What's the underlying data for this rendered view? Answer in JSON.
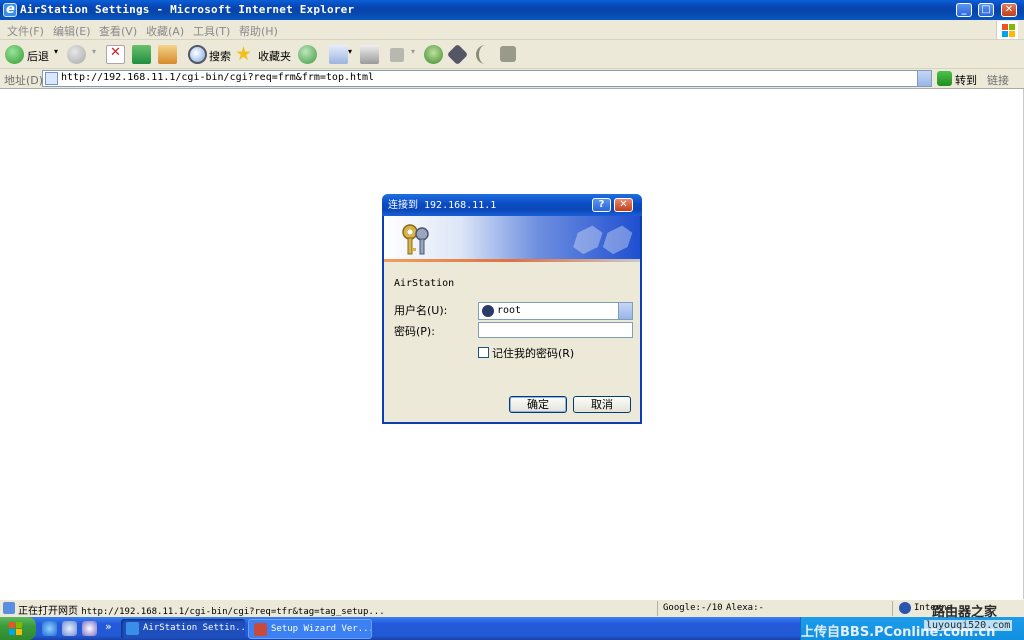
{
  "window": {
    "title": "AirStation Settings - Microsoft Internet Explorer"
  },
  "menu": {
    "items": [
      "文件(F)",
      "编辑(E)",
      "查看(V)",
      "收藏(A)",
      "工具(T)",
      "帮助(H)"
    ]
  },
  "toolbar": {
    "back_label": "后退",
    "search_label": "搜索",
    "favorites_label": "收藏夹"
  },
  "address": {
    "label": "地址(D)",
    "url": "http://192.168.11.1/cgi-bin/cgi?req=frm&frm=top.html",
    "go_label": "转到",
    "links_label": "链接"
  },
  "dialog": {
    "title": "连接到 192.168.11.1",
    "realm": "AirStation",
    "username_label": "用户名(U):",
    "username_value": "root",
    "password_label": "密码(P):",
    "remember_label": "记住我的密码(R)",
    "ok_label": "确定",
    "cancel_label": "取消",
    "help_glyph": "?",
    "close_glyph": "✕"
  },
  "status": {
    "text": "正在打开网页",
    "url": "http://192.168.11.1/cgi-bin/cgi?req=tfr&tag=tag_setup...",
    "google": "Google:-/10",
    "alexa": "Alexa:-",
    "zone": "Interne"
  },
  "taskbar": {
    "tasks": [
      {
        "label": "AirStation Settin..."
      },
      {
        "label": "Setup Wizard  Ver..."
      }
    ],
    "watermark": "上传自BBS.PConline.com.cn"
  },
  "sitemark": {
    "line1": "路由器之家",
    "line2": "luyouqi520.com"
  },
  "colors": {
    "titlebar": "#0a4bc4",
    "taskbar": "#245edb",
    "start": "#3a9a3a"
  }
}
